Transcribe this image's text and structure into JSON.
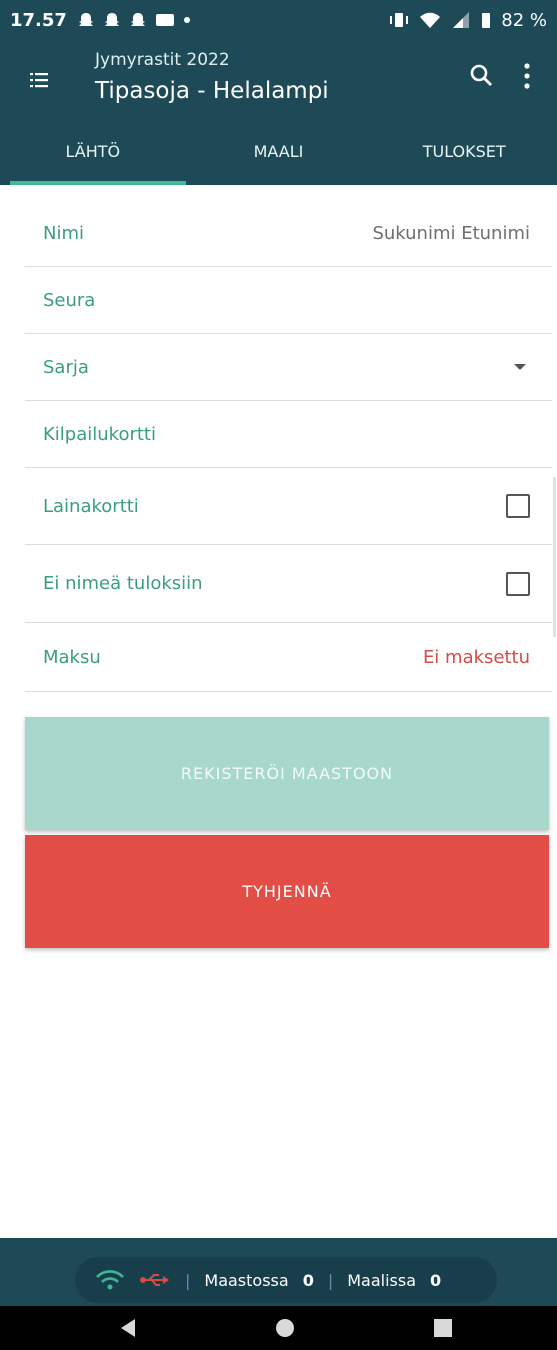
{
  "status_bar": {
    "time": "17.57",
    "battery": "82 %"
  },
  "app_bar": {
    "subtitle": "Jymyrastit 2022",
    "title": "Tipasoja - Helalampi"
  },
  "tabs": [
    {
      "label": "LÄHTÖ",
      "active": true
    },
    {
      "label": "MAALI",
      "active": false
    },
    {
      "label": "TULOKSET",
      "active": false
    }
  ],
  "form": {
    "nimi": {
      "label": "Nimi",
      "placeholder": "Sukunimi Etunimi"
    },
    "seura": {
      "label": "Seura"
    },
    "sarja": {
      "label": "Sarja"
    },
    "kilpailukortti": {
      "label": "Kilpailukortti"
    },
    "lainakortti": {
      "label": "Lainakortti",
      "checked": false
    },
    "ei_nimea": {
      "label": "Ei nimeä tuloksiin",
      "checked": false
    },
    "maksu": {
      "label": "Maksu",
      "value": "Ei maksettu"
    }
  },
  "buttons": {
    "register": "REKISTERÖI MAASTOON",
    "clear": "TYHJENNÄ"
  },
  "bottom_status": {
    "maastossa_label": "Maastossa",
    "maastossa_count": "0",
    "maalissa_label": "Maalissa",
    "maalissa_count": "0"
  },
  "colors": {
    "primary": "#1e4a58",
    "accent": "#3fb896",
    "label": "#3a9d83",
    "danger": "#e24d45",
    "register_disabled": "#a8d8cb"
  },
  "icons": [
    "menu-icon",
    "search-icon",
    "more-vert-icon",
    "dropdown-caret-icon",
    "wifi-icon",
    "usb-icon",
    "back-icon",
    "home-icon",
    "recent-apps-icon"
  ]
}
